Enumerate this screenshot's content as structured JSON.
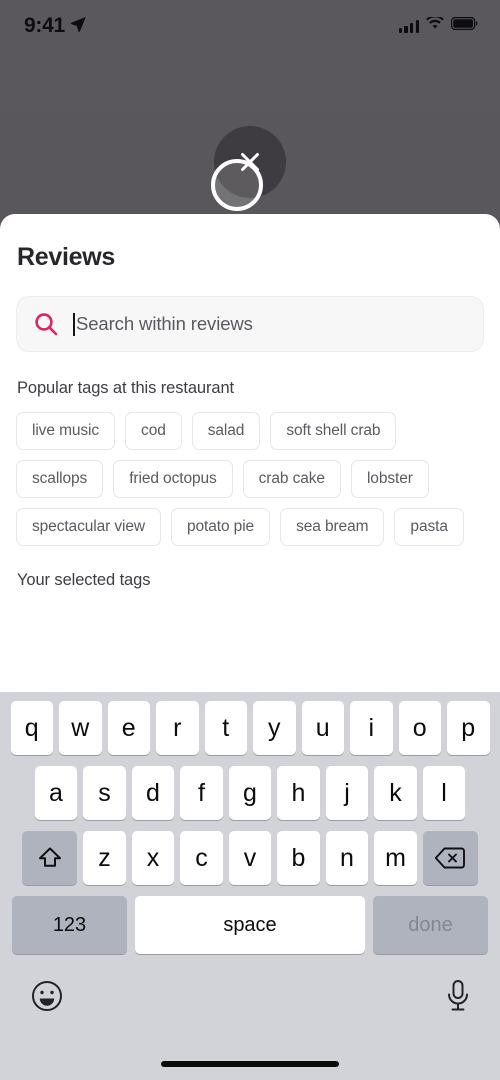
{
  "status_bar": {
    "time": "9:41",
    "location_icon": "location-arrow-icon",
    "signal_icon": "cellular-signal-icon",
    "wifi_icon": "wifi-icon",
    "battery_icon": "battery-full-icon"
  },
  "overlay": {
    "close_icon": "close-x-icon",
    "touch_indicator": "touch-ring-indicator"
  },
  "sheet": {
    "title": "Reviews",
    "search": {
      "icon": "search-icon",
      "placeholder": "Search within reviews",
      "value": "",
      "accent_color": "#dd2461"
    },
    "popular_tags_label": "Popular tags at this restaurant",
    "popular_tags": [
      "live music",
      "cod",
      "salad",
      "soft shell crab",
      "scallops",
      "fried octopus",
      "crab cake",
      "lobster",
      "spectacular view",
      "potato pie",
      "sea bream",
      "pasta"
    ],
    "selected_tags_label": "Your selected tags",
    "selected_tags": []
  },
  "keyboard": {
    "row1": [
      "q",
      "w",
      "e",
      "r",
      "t",
      "y",
      "u",
      "i",
      "o",
      "p"
    ],
    "row2": [
      "a",
      "s",
      "d",
      "f",
      "g",
      "h",
      "j",
      "k",
      "l"
    ],
    "row3": [
      "z",
      "x",
      "c",
      "v",
      "b",
      "n",
      "m"
    ],
    "shift_icon": "shift-arrow-icon",
    "backspace_icon": "backspace-delete-icon",
    "numeric_label": "123",
    "space_label": "space",
    "done_label": "done",
    "emoji_icon": "emoji-smiley-icon",
    "dictation_icon": "microphone-icon"
  }
}
